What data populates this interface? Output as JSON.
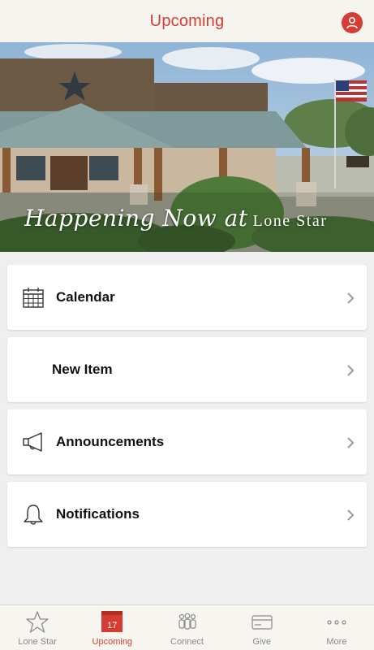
{
  "header": {
    "title": "Upcoming"
  },
  "hero": {
    "script_text": "Happening Now at",
    "caps_text": "Lone Star"
  },
  "menu": {
    "items": [
      {
        "label": "Calendar",
        "icon": "calendar-icon"
      },
      {
        "label": "New Item",
        "icon": ""
      },
      {
        "label": "Announcements",
        "icon": "megaphone-icon"
      },
      {
        "label": "Notifications",
        "icon": "bell-icon"
      }
    ]
  },
  "tabbar": {
    "tabs": [
      {
        "label": "Lone Star",
        "icon": "star-icon",
        "active": false
      },
      {
        "label": "Upcoming",
        "icon": "calendar-badge-icon",
        "active": true,
        "badge": "17"
      },
      {
        "label": "Connect",
        "icon": "people-icon",
        "active": false
      },
      {
        "label": "Give",
        "icon": "card-icon",
        "active": false
      },
      {
        "label": "More",
        "icon": "more-icon",
        "active": false
      }
    ]
  },
  "colors": {
    "accent": "#d63b34",
    "header_bg": "#f6f4ee",
    "page_bg": "#efefef",
    "inactive": "#8a8a8a"
  }
}
